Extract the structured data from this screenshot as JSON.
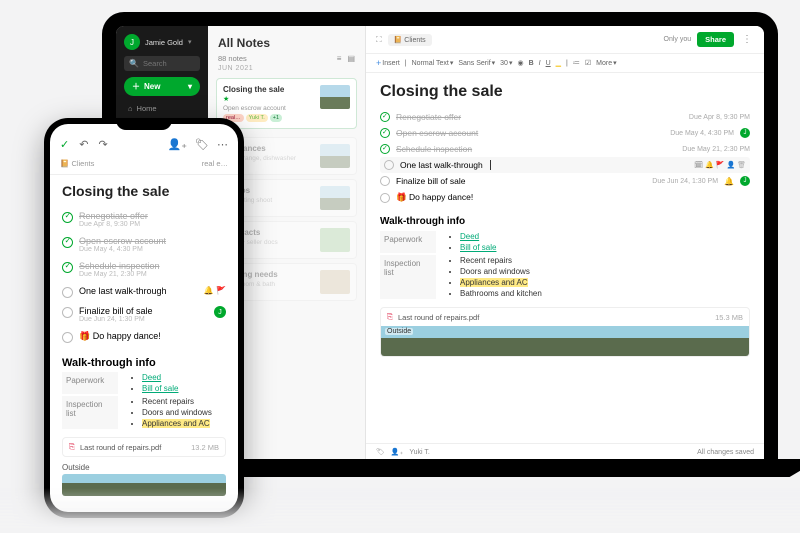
{
  "laptop": {
    "sidebar": {
      "user_initial": "J",
      "user_name": "Jamie Gold",
      "search_placeholder": "Search",
      "new_label": "New",
      "nav": {
        "home": "Home"
      }
    },
    "noteslist": {
      "title": "All Notes",
      "count": "88 notes",
      "date_header": "JUN 2021",
      "cards": [
        {
          "title": "Closing the sale",
          "snippet": "Open escrow account",
          "tag1": "real…",
          "tag2": "Yuki T.",
          "extra": "+1"
        },
        {
          "title": "Appliances",
          "snippet": "fridge, range, dishwasher"
        },
        {
          "title": "Photos",
          "snippet": "from listing shoot"
        },
        {
          "title": "Contracts",
          "snippet": "buyer + seller docs"
        },
        {
          "title": "Staging needs",
          "snippet": "living room & bath"
        }
      ]
    },
    "editor": {
      "breadcrumb": "Clients",
      "only_you": "Only you",
      "share": "Share",
      "toolbar": {
        "insert": "Insert",
        "style": "Normal Text",
        "font": "Sans Serif",
        "size": "30",
        "more": "More"
      },
      "title": "Closing the sale",
      "todos": [
        {
          "label": "Renegotiate offer",
          "due": "Due Apr 8, 9:30 PM",
          "done": true
        },
        {
          "label": "Open escrow account",
          "due": "Due May 4, 4:30 PM",
          "done": true,
          "avatar": "J"
        },
        {
          "label": "Schedule inspection",
          "due": "Due May 21, 2:30 PM",
          "done": true
        },
        {
          "label": "One last walk-through",
          "due": "",
          "done": false,
          "focused": true
        },
        {
          "label": "Finalize bill of sale",
          "due": "Due Jun 24, 1:30 PM",
          "done": false,
          "avatar": "J"
        },
        {
          "label": "🎁 Do happy dance!",
          "due": "",
          "done": false
        }
      ],
      "section_heading": "Walk-through info",
      "paperwork_label": "Paperwork",
      "paperwork_items": [
        "Deed",
        "Bill of sale"
      ],
      "inspection_label": "Inspection list",
      "inspection_items": [
        "Recent repairs",
        "Doors and windows",
        "Appliances and AC",
        "Bathrooms and kitchen"
      ],
      "attachment": {
        "name": "Last round of repairs.pdf",
        "size": "15.3 MB",
        "caption": "Outside"
      },
      "footer": {
        "collaborator": "Yuki T.",
        "status": "All changes saved"
      }
    }
  },
  "phone": {
    "breadcrumb": "Clients",
    "breadcrumb_right": "real e…",
    "title": "Closing the sale",
    "todos": [
      {
        "label": "Renegotiate offer",
        "due": "Due Apr 8, 9:30 PM",
        "done": true
      },
      {
        "label": "Open escrow account",
        "due": "Due May 4, 4:30 PM",
        "done": true
      },
      {
        "label": "Schedule inspection",
        "due": "Due May 21, 2:30 PM",
        "done": true
      },
      {
        "label": "One last walk-through",
        "due": "",
        "done": false,
        "flags": true
      },
      {
        "label": "Finalize bill of sale",
        "due": "Due Jun 24, 1:30 PM",
        "done": false,
        "avatar": "J"
      },
      {
        "label": "🎁 Do happy dance!",
        "due": "",
        "done": false
      }
    ],
    "section_heading": "Walk-through info",
    "paperwork_label": "Paperwork",
    "paperwork_items": [
      "Deed",
      "Bill of sale"
    ],
    "inspection_label": "Inspection list",
    "inspection_items": [
      "Recent repairs",
      "Doors and windows",
      "Appliances and AC"
    ],
    "attachment": {
      "name": "Last round of repairs.pdf",
      "size": "13.2 MB",
      "caption": "Outside"
    }
  }
}
